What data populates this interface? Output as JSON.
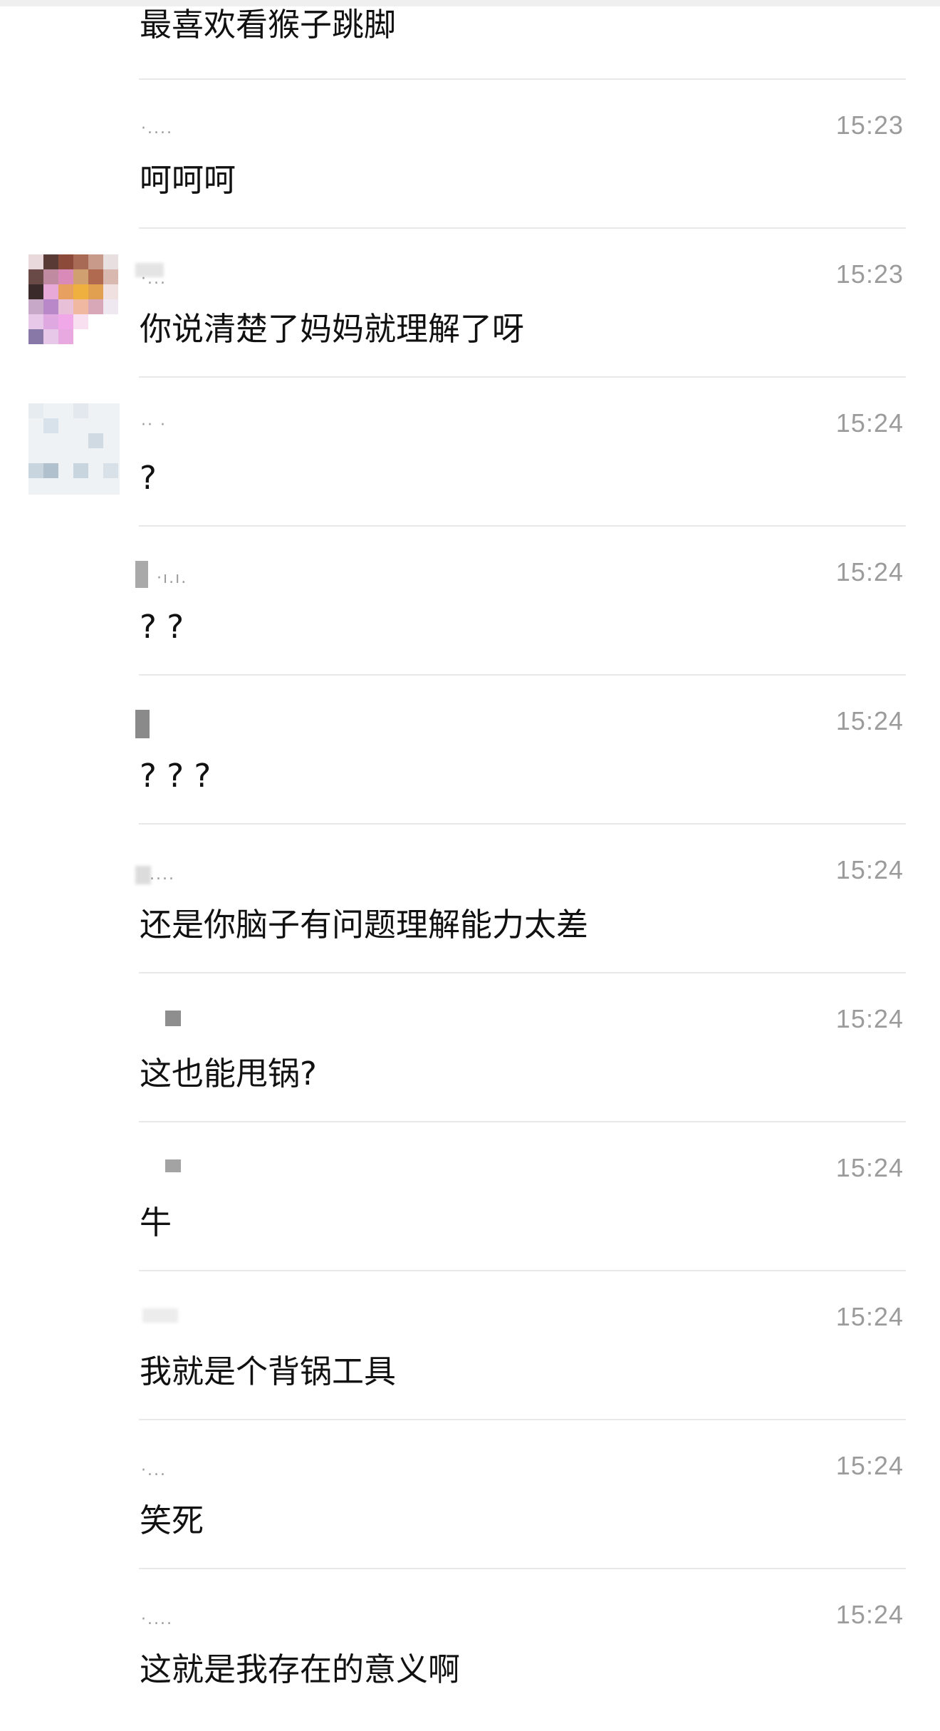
{
  "messages": [
    {
      "text": "最喜欢看猴子跳脚",
      "time": ""
    },
    {
      "text": "呵呵呵",
      "time": "15:23"
    },
    {
      "text": "你说清楚了妈妈就理解了呀",
      "time": "15:23"
    },
    {
      "text": "?",
      "time": "15:24"
    },
    {
      "text": "? ?",
      "time": "15:24"
    },
    {
      "text": "? ? ?",
      "time": "15:24"
    },
    {
      "text": "还是你脑子有问题理解能力太差",
      "time": "15:24"
    },
    {
      "text": "这也能甩锅?",
      "time": "15:24"
    },
    {
      "text": "牛",
      "time": "15:24"
    },
    {
      "text": "我就是个背锅工具",
      "time": "15:24"
    },
    {
      "text": "笑死",
      "time": "15:24"
    },
    {
      "text": "这就是我存在的意义啊",
      "time": "15:24"
    }
  ],
  "colors": {
    "text": "#111111",
    "time": "#9b9b9b",
    "divider": "#e8e8e8",
    "top_bar": "#efefef"
  }
}
